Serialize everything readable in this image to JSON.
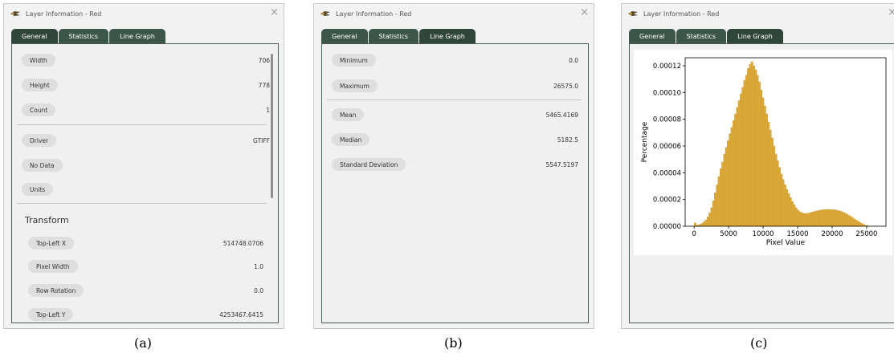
{
  "window_title": "Layer Information - Red",
  "close_glyph": "×",
  "tabs": [
    "General",
    "Statistics",
    "Line Graph"
  ],
  "general": {
    "rows": [
      {
        "label": "Width",
        "value": "706"
      },
      {
        "label": "Height",
        "value": "778"
      },
      {
        "label": "Count",
        "value": "1"
      },
      {
        "label": "Driver",
        "value": "GTIFF"
      },
      {
        "label": "No Data",
        "value": ""
      },
      {
        "label": "Units",
        "value": ""
      }
    ],
    "transform_title": "Transform",
    "transform_rows": [
      {
        "label": "Top-Left X",
        "value": "514748.0706"
      },
      {
        "label": "Pixel Width",
        "value": "1.0"
      },
      {
        "label": "Row Rotation",
        "value": "0.0"
      },
      {
        "label": "Top-Left Y",
        "value": "4253467.6415"
      }
    ]
  },
  "statistics": {
    "rows": [
      {
        "label": "Minimum",
        "value": "0.0"
      },
      {
        "label": "Maximum",
        "value": "26575.0"
      },
      {
        "label": "Mean",
        "value": "5465.4169"
      },
      {
        "label": "Median",
        "value": "5182.5"
      },
      {
        "label": "Standard Deviation",
        "value": "5547.5197"
      }
    ]
  },
  "captions": [
    "(a)",
    "(b)",
    "(c)"
  ],
  "colors": {
    "tab_bg": "#3c5749",
    "histogram_fill": "#dba93a",
    "histogram_edge": "#c99628"
  },
  "chart_data": {
    "type": "bar",
    "title": "",
    "xlabel": "Pixel Value",
    "ylabel": "Percentage",
    "xlim": [
      -1300,
      27800
    ],
    "ylim": [
      0,
      0.000126
    ],
    "xticks": [
      0,
      5000,
      10000,
      15000,
      20000,
      25000
    ],
    "xtick_labels": [
      "0",
      "5000",
      "10000",
      "15000",
      "20000",
      "25000"
    ],
    "yticks": [
      0,
      2e-05,
      4e-05,
      6e-05,
      8e-05,
      0.0001,
      0.00012
    ],
    "ytick_labels": [
      "0.00000",
      "0.00002",
      "0.00004",
      "0.00006",
      "0.00008",
      "0.00010",
      "0.00012"
    ],
    "grid": false,
    "bin_start": 0,
    "bin_width": 265.75,
    "values": [
      2.5e-06,
      8e-07,
      1e-06,
      1.5e-06,
      2.2e-06,
      3.5e-06,
      4.8e-06,
      7e-06,
      1e-05,
      1.4e-05,
      1.9e-05,
      2.5e-05,
      3.1e-05,
      3.7e-05,
      4.3e-05,
      4.8e-05,
      5.4e-05,
      5.9e-05,
      6.4e-05,
      6.9e-05,
      7.4e-05,
      7.9e-05,
      8.4e-05,
      8.9e-05,
      9.4e-05,
      9.9e-05,
      0.000104,
      0.000109,
      0.000113,
      0.000118,
      0.000121,
      0.000123,
      0.00012,
      0.000117,
      0.000113,
      0.000108,
      0.000102,
      9.6e-05,
      9e-05,
      8.4e-05,
      7.8e-05,
      7.2e-05,
      6.6e-05,
      6e-05,
      5.4e-05,
      4.9e-05,
      4.4e-05,
      3.9e-05,
      3.5e-05,
      3.1e-05,
      2.75e-05,
      2.45e-05,
      2.15e-05,
      1.85e-05,
      1.6e-05,
      1.4e-05,
      1.22e-05,
      1.1e-05,
      1.02e-05,
      9.8e-06,
      9.5e-06,
      9.6e-06,
      9.9e-06,
      1.02e-05,
      1.06e-05,
      1.1e-05,
      1.14e-05,
      1.17e-05,
      1.2e-05,
      1.22e-05,
      1.24e-05,
      1.25e-05,
      1.26e-05,
      1.26e-05,
      1.25e-05,
      1.24e-05,
      1.23e-05,
      1.21e-05,
      1.18e-05,
      1.14e-05,
      1.09e-05,
      1.03e-05,
      9.6e-06,
      8.8e-06,
      8e-06,
      7.2e-06,
      6.3e-06,
      5.4e-06,
      4.5e-06,
      3.6e-06,
      2.8e-06,
      2e-06,
      1.3e-06,
      8e-07,
      4e-07,
      2e-07,
      1e-07,
      1e-07,
      1e-07,
      1e-07
    ]
  }
}
